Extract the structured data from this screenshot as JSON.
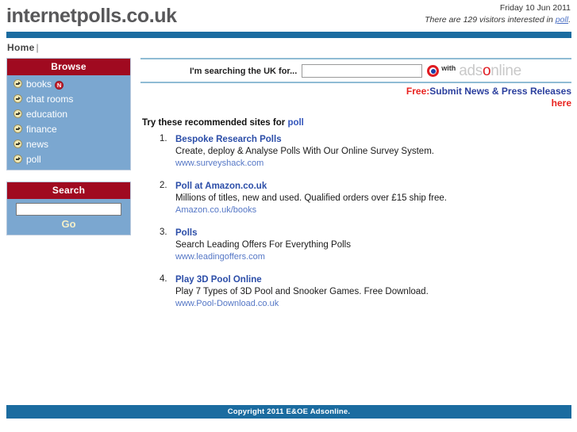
{
  "header": {
    "site_title": "internetpolls.co.uk",
    "date": "Friday 10 Jun 2011",
    "visitor_prefix": "There are 129 visitors interested in ",
    "visitor_keyword": "poll",
    "visitor_suffix": ".",
    "visitor_count": 129
  },
  "breadcrumb": {
    "home_label": "Home",
    "separator": "|"
  },
  "sidebar": {
    "browse": {
      "title": "Browse",
      "items": [
        {
          "label": "books",
          "badge": "N"
        },
        {
          "label": "chat rooms",
          "badge": ""
        },
        {
          "label": "education",
          "badge": ""
        },
        {
          "label": "finance",
          "badge": ""
        },
        {
          "label": "news",
          "badge": ""
        },
        {
          "label": "poll",
          "badge": ""
        }
      ]
    },
    "search": {
      "title": "Search",
      "input_value": "",
      "input_placeholder": "",
      "go_label": "Go"
    }
  },
  "main": {
    "searchbar": {
      "label": "I'm searching the UK for...",
      "input_value": "",
      "input_placeholder": "",
      "with_label": "with",
      "logo_part1": "ads",
      "logo_accent": "o",
      "logo_part2": "nline"
    },
    "promo": {
      "free_label": "Free:",
      "main_label": "Submit News & Press Releases",
      "here_label": "here"
    },
    "results_heading_prefix": "Try these recommended sites for ",
    "results_heading_keyword": "poll",
    "results": [
      {
        "num": "1.",
        "title": "Bespoke Research Polls",
        "desc": "Create, deploy & Analyse Polls With Our Online Survey System.",
        "url": "www.surveyshack.com"
      },
      {
        "num": "2.",
        "title": "Poll at Amazon.co.uk",
        "desc": "Millions of titles, new and used. Qualified orders over £15 ship free.",
        "url": "Amazon.co.uk/books"
      },
      {
        "num": "3.",
        "title": "Polls",
        "desc": "Search Leading Offers For Everything Polls",
        "url": "www.leadingoffers.com"
      },
      {
        "num": "4.",
        "title": "Play 3D Pool Online",
        "desc": "Play 7 Types of 3D Pool and Snooker Games. Free Download.",
        "url": "www.Pool-Download.co.uk"
      }
    ]
  },
  "footer": {
    "copyright": "Copyright 2011 E&OE Adsonline."
  },
  "colors": {
    "brand_blue": "#1b6ca0",
    "panel_red": "#A00A20",
    "panel_blue": "#7BA7D0",
    "link_blue": "#2B4DA8",
    "accent_red": "#E01B22",
    "go_cream": "#F4EFC8"
  }
}
